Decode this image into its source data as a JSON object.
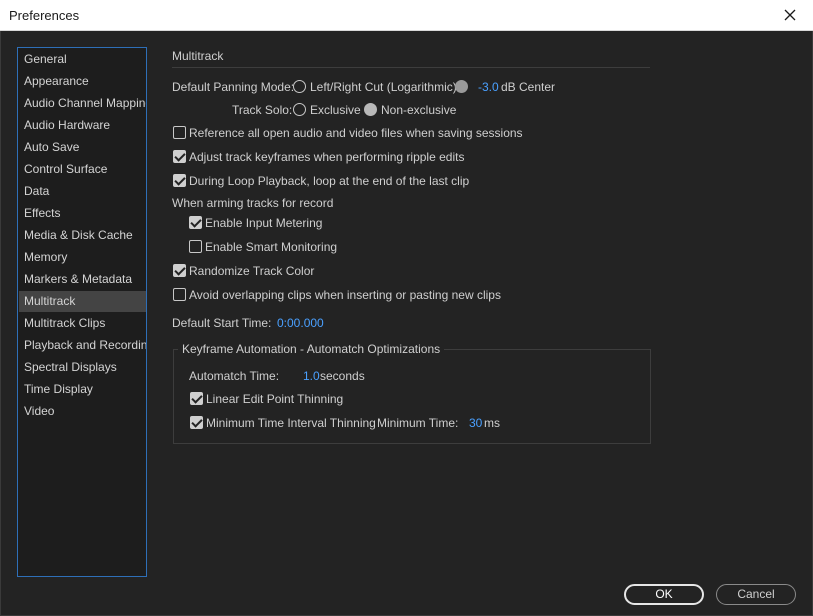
{
  "window": {
    "title": "Preferences"
  },
  "sidebar": {
    "items": [
      {
        "label": "General"
      },
      {
        "label": "Appearance"
      },
      {
        "label": "Audio Channel Mapping"
      },
      {
        "label": "Audio Hardware"
      },
      {
        "label": "Auto Save"
      },
      {
        "label": "Control Surface"
      },
      {
        "label": "Data"
      },
      {
        "label": "Effects"
      },
      {
        "label": "Media & Disk Cache"
      },
      {
        "label": "Memory"
      },
      {
        "label": "Markers & Metadata"
      },
      {
        "label": "Multitrack"
      },
      {
        "label": "Multitrack Clips"
      },
      {
        "label": "Playback and Recording"
      },
      {
        "label": "Spectral Displays"
      },
      {
        "label": "Time Display"
      },
      {
        "label": "Video"
      }
    ],
    "selected": "Multitrack"
  },
  "main": {
    "section_title": "Multitrack",
    "panning": {
      "label": "Default Panning Mode:",
      "option_left_right": "Left/Right Cut (Logarithmic)",
      "db_value": "-3.0",
      "db_suffix": "dB Center"
    },
    "track_solo": {
      "label": "Track Solo:",
      "option_exclusive": "Exclusive",
      "option_non_exclusive": "Non-exclusive"
    },
    "checkboxes": {
      "reference_all": "Reference all open audio and video files when saving sessions",
      "adjust_keyframes": "Adjust track keyframes when performing ripple edits",
      "loop_playback": "During Loop Playback, loop at the end of the last clip",
      "arming_header": "When arming tracks for record",
      "enable_input_metering": "Enable Input Metering",
      "enable_smart_monitoring": "Enable Smart Monitoring",
      "randomize_color": "Randomize Track Color",
      "avoid_overlapping": "Avoid overlapping clips when inserting or pasting new clips"
    },
    "default_start_time": {
      "label": "Default Start Time:",
      "value": "0:00.000"
    },
    "keyframe_group": {
      "title": "Keyframe Automation - Automatch Optimizations",
      "automatch_label": "Automatch Time:",
      "automatch_value": "1.0",
      "automatch_unit": "seconds",
      "linear_thinning": "Linear Edit Point Thinning",
      "min_interval_thinning": "Minimum Time Interval Thinning",
      "min_time_label": "Minimum Time:",
      "min_time_value": "30",
      "min_time_unit": "ms"
    }
  },
  "footer": {
    "ok_label": "OK",
    "cancel_label": "Cancel"
  },
  "colors": {
    "accent": "#4aa0ff",
    "selection": "#444444",
    "background": "#232323"
  }
}
